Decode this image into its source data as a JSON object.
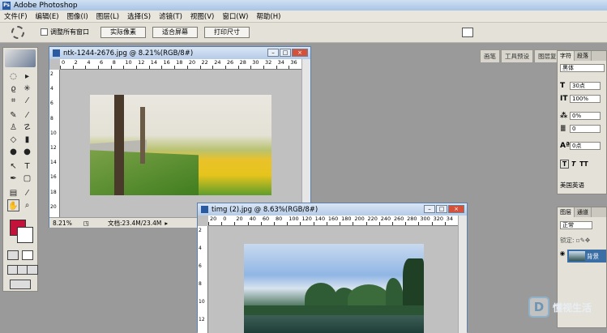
{
  "app": {
    "title": "Adobe Photoshop"
  },
  "menu": [
    "文件(F)",
    "编辑(E)",
    "图像(I)",
    "图层(L)",
    "选择(S)",
    "滤镜(T)",
    "视图(V)",
    "窗口(W)",
    "帮助(H)"
  ],
  "options": {
    "checkbox_label": "调整所有窗口",
    "btn_actual": "实际像素",
    "btn_fit": "适合屏幕",
    "btn_print": "打印尺寸"
  },
  "well_tabs": [
    "画笔",
    "工具预设",
    "图层复合"
  ],
  "doc1": {
    "title": "ntk-1244-2676.jpg @ 8.21%(RGB/8#)",
    "zoom": "8.21%",
    "status": "文档:23.4M/23.4M",
    "ruler_h": [
      "0",
      "2",
      "4",
      "6",
      "8",
      "10",
      "12",
      "14",
      "16",
      "18",
      "20",
      "22",
      "24",
      "26",
      "28",
      "30",
      "32",
      "34",
      "36"
    ],
    "ruler_v": [
      "2",
      "4",
      "6",
      "8",
      "10",
      "12",
      "14",
      "16",
      "18",
      "20"
    ]
  },
  "doc2": {
    "title": "timg (2).jpg @ 8.63%(RGB/8#)",
    "ruler_h": [
      "20",
      "0",
      "20",
      "40",
      "60",
      "80",
      "100",
      "120",
      "140",
      "160",
      "180",
      "200",
      "220",
      "240",
      "260",
      "280",
      "300",
      "320",
      "34"
    ],
    "ruler_v": [
      "2",
      "4",
      "6",
      "8",
      "10",
      "12"
    ]
  },
  "char_panel": {
    "tabs": [
      "字符",
      "段落"
    ],
    "font": "黑体",
    "size": "30点",
    "scale": "100%",
    "tracking": "0%",
    "kern": "0",
    "baseline": "0点",
    "lang": "美国英语",
    "style_btns": [
      "T",
      "T",
      "TT"
    ]
  },
  "layers_panel": {
    "tabs": [
      "图层",
      "通道"
    ],
    "blend": "正常",
    "lock_label": "锁定:",
    "layer_name": "背景"
  },
  "watermark": {
    "logo": "D",
    "text": "懂视生活"
  },
  "colors": {
    "foreground": "#c4123a",
    "background": "#ffffff"
  }
}
